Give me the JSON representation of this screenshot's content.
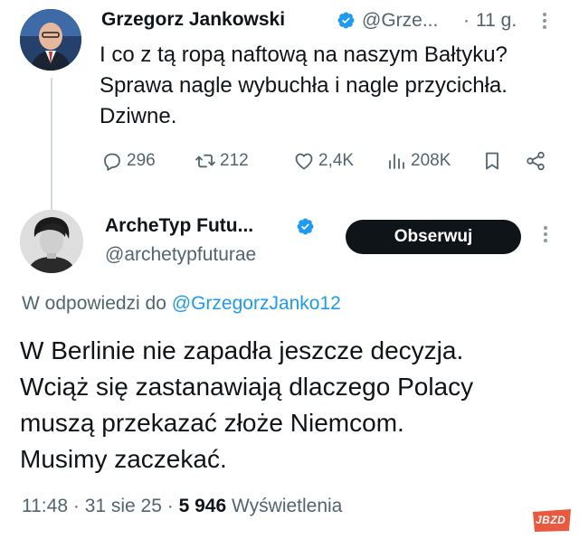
{
  "tweet1": {
    "display_name": "Grzegorz Jankowski",
    "handle": "@Grze...",
    "separator": "·",
    "time": "11 g.",
    "text_lines": [
      "I co z tą ropą naftową na naszym Bałtyku?",
      "Sprawa nagle wybuchła i nagle przycichła.",
      "Dziwne."
    ],
    "actions": {
      "replies": "296",
      "retweets": "212",
      "likes": "2,4K",
      "views": "208K"
    }
  },
  "tweet2": {
    "display_name": "ArcheTyp Futu...",
    "handle": "@archetypfuturae",
    "follow_label": "Obserwuj",
    "reply_prefix": "W odpowiedzi do",
    "reply_to": "@GrzegorzJanko12",
    "text_lines": [
      "W Berlinie nie zapadła jeszcze decyzja.",
      "Wciąż się zastanawiają dlaczego Polacy",
      "muszą przekazać złoże Niemcom.",
      "Musimy zaczekać."
    ],
    "meta": {
      "time": "11:48",
      "sep1": "·",
      "date": "31 sie 25",
      "sep2": "·",
      "views_count": "5 946",
      "views_label": "Wyświetlenia"
    }
  },
  "watermark": "JBZD",
  "colors": {
    "text": "#0f1419",
    "muted": "#536471",
    "link": "#1d9bf0",
    "verified": "#1d9bf0",
    "button_bg": "#0f1419",
    "watermark": "#e8593f"
  }
}
